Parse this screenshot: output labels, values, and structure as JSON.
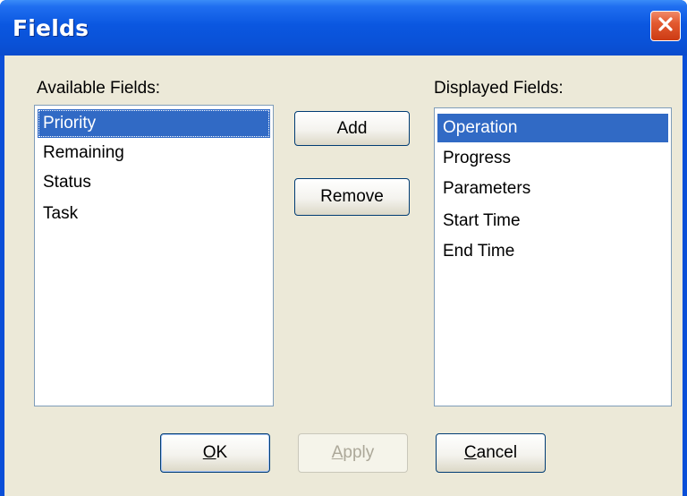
{
  "window": {
    "title": "Fields"
  },
  "available": {
    "label": "Available Fields:",
    "items": [
      "Priority",
      "Remaining",
      "Status",
      "Task"
    ],
    "selected_index": 0
  },
  "displayed": {
    "label": "Displayed Fields:",
    "items": [
      "Operation",
      "Progress",
      "Parameters",
      "Start Time",
      "End Time"
    ],
    "selected_index": 0
  },
  "buttons": {
    "add": "Add",
    "remove": "Remove",
    "ok_mnemonic": "O",
    "ok_rest": "K",
    "apply_mnemonic": "A",
    "apply_rest": "pply",
    "cancel_mnemonic": "C",
    "cancel_rest": "ancel"
  },
  "colors": {
    "titlebar": "#0a52d8",
    "selection": "#316ac5",
    "dialog_face": "#ece9d8",
    "close_button": "#e35a30"
  },
  "icons": {
    "close": "close-icon"
  }
}
